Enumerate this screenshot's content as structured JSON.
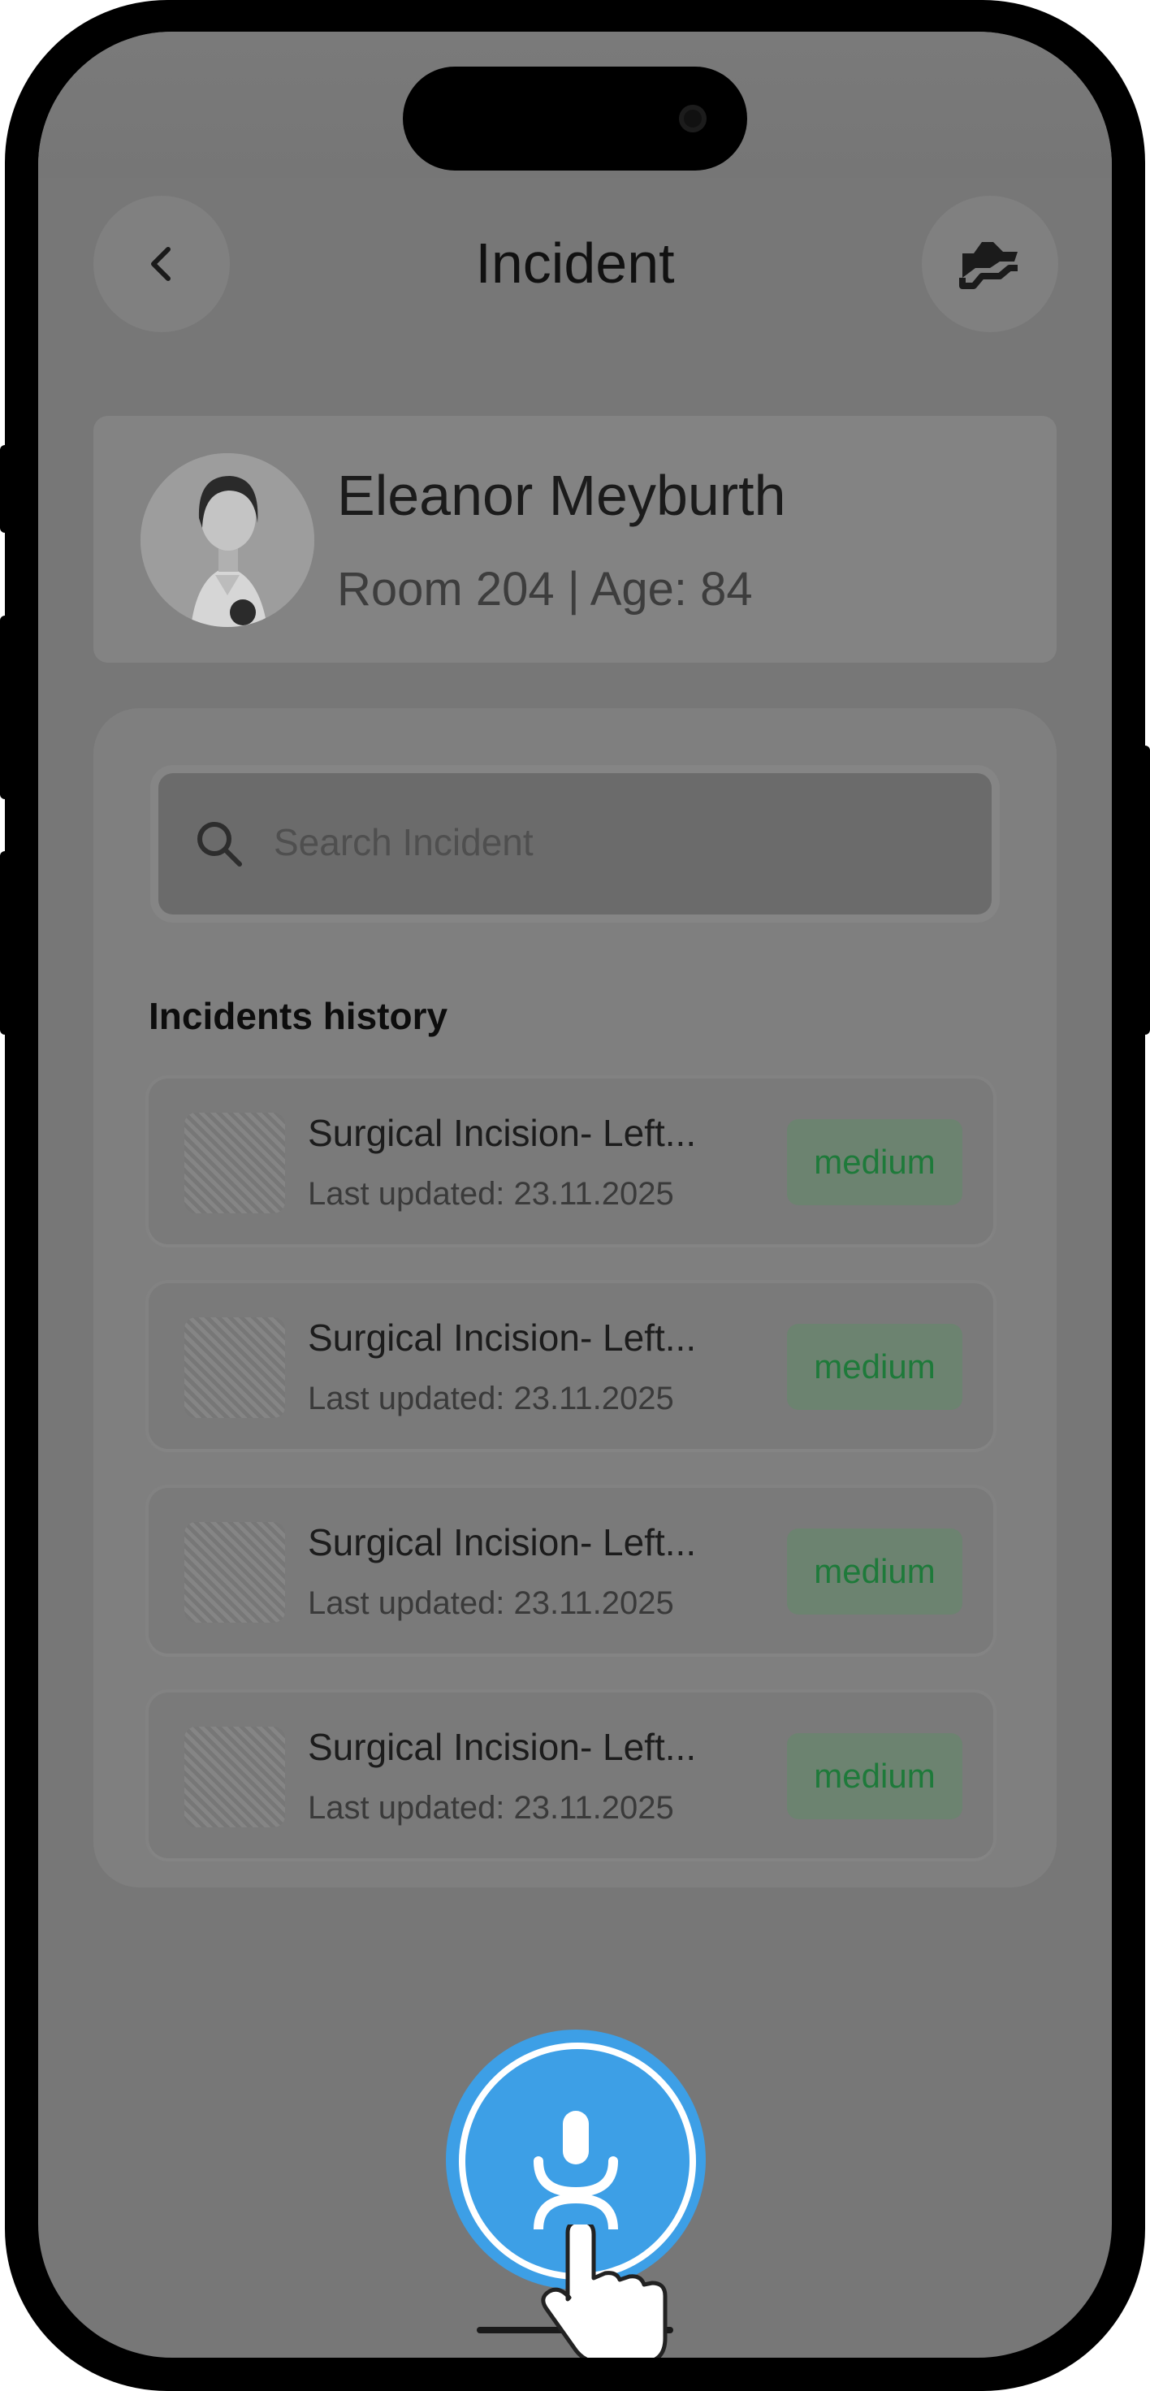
{
  "header": {
    "title": "Incident",
    "back_icon": "chevron-left-icon",
    "action_icon": "transfer-hand-icon"
  },
  "patient": {
    "name": "Eleanor Meyburth",
    "meta": "Room 204 | Age: 84"
  },
  "search": {
    "placeholder": "Search Incident"
  },
  "history": {
    "title": "Incidents history",
    "items": [
      {
        "title": "Surgical Incision- Left...",
        "updated": "Last updated: 23.11.2025",
        "severity": "medium"
      },
      {
        "title": "Surgical Incision- Left...",
        "updated": "Last updated: 23.11.2025",
        "severity": "medium"
      },
      {
        "title": "Surgical Incision- Left...",
        "updated": "Last updated: 23.11.2025",
        "severity": "medium"
      },
      {
        "title": "Surgical Incision- Left...",
        "updated": "Last updated: 23.11.2025",
        "severity": "medium"
      }
    ]
  },
  "voice": {
    "icon": "voice-assistant-mic-icon",
    "accent": "#3d9fe6"
  },
  "colors": {
    "severity_medium_text": "#1e7a3a",
    "overlay_dim": "#777777"
  }
}
